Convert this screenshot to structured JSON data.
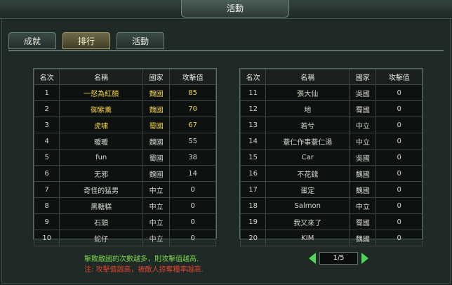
{
  "window": {
    "title": "活動"
  },
  "tabs": [
    {
      "label": "成就",
      "active": false
    },
    {
      "label": "排行",
      "active": true
    },
    {
      "label": "活動",
      "active": false
    }
  ],
  "table": {
    "headers": [
      "名次",
      "名稱",
      "國家",
      "攻擊值"
    ],
    "left_rows": [
      {
        "rank": "1",
        "name": "一怒為紅顏",
        "country": "魏國",
        "attack": "85",
        "highlight": true
      },
      {
        "rank": "2",
        "name": "御紫薰",
        "country": "魏國",
        "attack": "70",
        "highlight": true
      },
      {
        "rank": "3",
        "name": "虎啸",
        "country": "蜀國",
        "attack": "67",
        "highlight": true
      },
      {
        "rank": "4",
        "name": "暖暖",
        "country": "魏國",
        "attack": "55",
        "highlight": false
      },
      {
        "rank": "5",
        "name": "fun",
        "country": "蜀國",
        "attack": "38",
        "highlight": false
      },
      {
        "rank": "6",
        "name": "无邪",
        "country": "魏國",
        "attack": "14",
        "highlight": false
      },
      {
        "rank": "7",
        "name": "奇怪的猛男",
        "country": "中立",
        "attack": "0",
        "highlight": false
      },
      {
        "rank": "8",
        "name": "黑糖糕",
        "country": "中立",
        "attack": "0",
        "highlight": false
      },
      {
        "rank": "9",
        "name": "石頭",
        "country": "中立",
        "attack": "0",
        "highlight": false
      },
      {
        "rank": "10",
        "name": "蛇仔",
        "country": "中立",
        "attack": "0",
        "highlight": false
      }
    ],
    "right_rows": [
      {
        "rank": "11",
        "name": "張大仙",
        "country": "吳國",
        "attack": "0"
      },
      {
        "rank": "12",
        "name": "地",
        "country": "蜀國",
        "attack": "0"
      },
      {
        "rank": "13",
        "name": "若兮",
        "country": "中立",
        "attack": "0"
      },
      {
        "rank": "14",
        "name": "薏仁作事薏仁湯",
        "country": "中立",
        "attack": "0"
      },
      {
        "rank": "15",
        "name": "Car",
        "country": "吳國",
        "attack": "0"
      },
      {
        "rank": "16",
        "name": "不花錢",
        "country": "魏國",
        "attack": "0"
      },
      {
        "rank": "17",
        "name": "蛋定",
        "country": "魏國",
        "attack": "0"
      },
      {
        "rank": "18",
        "name": "Salmon",
        "country": "中立",
        "attack": "0"
      },
      {
        "rank": "19",
        "name": "我又來了",
        "country": "蜀國",
        "attack": "0"
      },
      {
        "rank": "20",
        "name": "KIM",
        "country": "魏國",
        "attack": "0"
      }
    ]
  },
  "footer": {
    "message_green": "擊敗敵國的次數越多，則攻擊值越高.",
    "message_red": "注: 攻擊值越高，被敵人掠奪糧率越高.",
    "page_indicator": "1/5"
  },
  "colors": {
    "highlight": "#f2d24a",
    "message_green": "#79d14a",
    "message_red": "#e0412e",
    "arrow": "#4fd15a"
  }
}
